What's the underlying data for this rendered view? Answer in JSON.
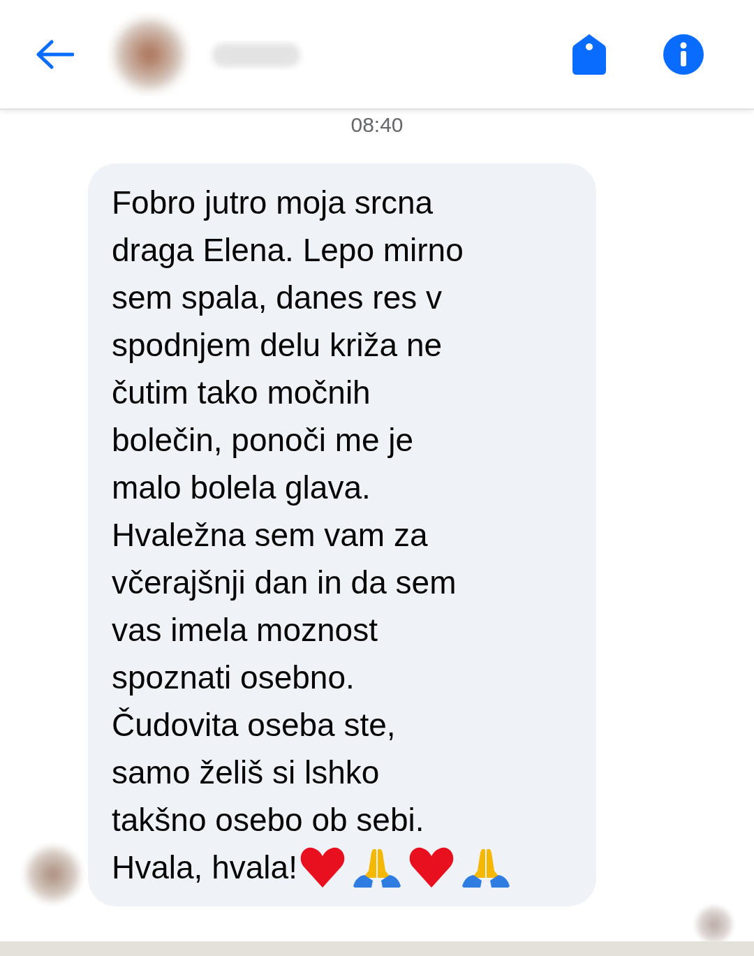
{
  "header": {
    "actions": [
      {
        "kind": "tag"
      },
      {
        "kind": "info"
      }
    ]
  },
  "timestamp": "08:40",
  "message": {
    "text": "Fobro jutro moja srcna\ndraga Elena. Lepo mirno\nsem spala, danes res v\nspodnjem delu križa ne\nčutim tako močnih\nbolečin, ponoči me je\nmalo bolela glava.\nHvaležna sem vam za\nvčerajšnji dan in da sem\nvas imela moznost\nspoznati osebno.\nČudovita oseba ste,\nsamo želiš si lshko\ntakšno osebo ob sebi.",
    "closing": "Hvala, hvala!",
    "emoji": [
      {
        "kind": "heart"
      },
      {
        "kind": "pray"
      },
      {
        "kind": "heart"
      },
      {
        "kind": "pray"
      }
    ]
  }
}
